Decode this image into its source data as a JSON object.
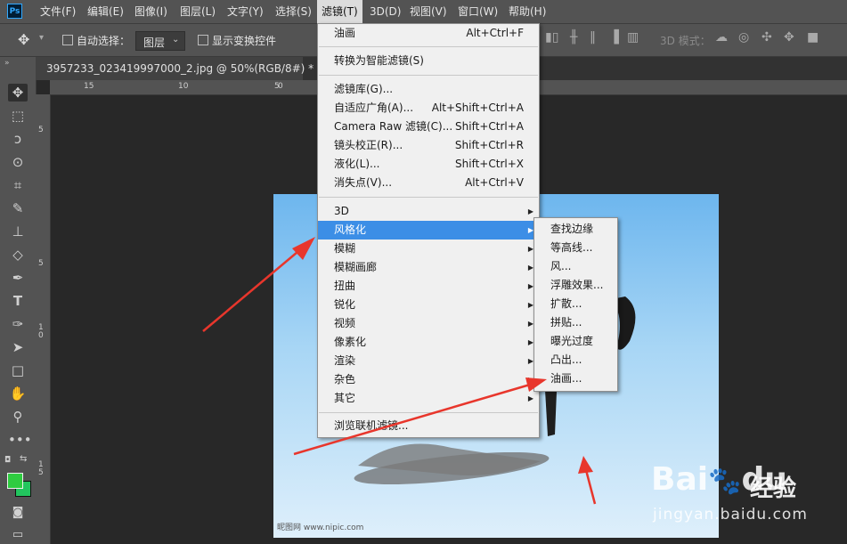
{
  "app": {
    "logo_text": "Ps"
  },
  "menubar": {
    "items": [
      "文件(F)",
      "编辑(E)",
      "图像(I)",
      "图层(L)",
      "文字(Y)",
      "选择(S)",
      "滤镜(T)",
      "3D(D)",
      "视图(V)",
      "窗口(W)",
      "帮助(H)"
    ],
    "active_index": 6
  },
  "options": {
    "auto_select_label": "自动选择：",
    "layer_select_value": "图层",
    "show_transform_label": "显示变换控件",
    "mode_3d_label": "3D 模式："
  },
  "document": {
    "tab_title": "3957233_023419997000_2.jpg @ 50%(RGB/8#) *"
  },
  "ruler": {
    "top_ticks": [
      "15",
      "10",
      "5",
      "0",
      "5"
    ],
    "left_ticks": [
      "5",
      "5",
      "1 0",
      "1 5"
    ]
  },
  "filter_menu": {
    "group1": [
      {
        "label": "油画",
        "shortcut": "Alt+Ctrl+F"
      }
    ],
    "group2": [
      {
        "label": "转换为智能滤镜(S)",
        "shortcut": ""
      }
    ],
    "group3": [
      {
        "label": "滤镜库(G)...",
        "shortcut": ""
      },
      {
        "label": "自适应广角(A)...",
        "shortcut": "Alt+Shift+Ctrl+A"
      },
      {
        "label": "Camera Raw 滤镜(C)...",
        "shortcut": "Shift+Ctrl+A"
      },
      {
        "label": "镜头校正(R)...",
        "shortcut": "Shift+Ctrl+R"
      },
      {
        "label": "液化(L)...",
        "shortcut": "Shift+Ctrl+X"
      },
      {
        "label": "消失点(V)...",
        "shortcut": "Alt+Ctrl+V"
      }
    ],
    "group4": [
      "3D",
      "风格化",
      "模糊",
      "模糊画廊",
      "扭曲",
      "锐化",
      "视频",
      "像素化",
      "渲染",
      "杂色",
      "其它"
    ],
    "highlighted": "风格化",
    "group5": [
      "浏览联机滤镜..."
    ]
  },
  "stylize_menu": {
    "items": [
      "查找边缘",
      "等高线...",
      "风...",
      "浮雕效果...",
      "扩散...",
      "拼贴...",
      "曝光过度",
      "凸出...",
      "油画..."
    ]
  },
  "watermark": {
    "left_text": "昵图网 www.nipic.com",
    "brand_bai": "Bai",
    "brand_du": "du",
    "brand_jingyan": "经验",
    "url": "jingyan.baidu.com"
  },
  "colors": {
    "accent": "#3c8ee6",
    "annotation": "#e8362c",
    "foreground": "#2ecc40"
  }
}
